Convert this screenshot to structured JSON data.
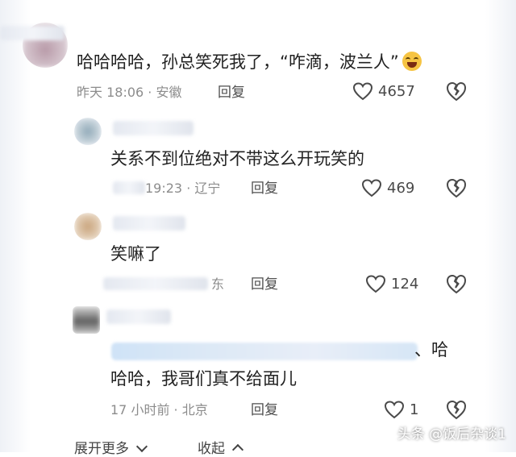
{
  "comments": [
    {
      "text": "哈哈哈哈，孙总笑死我了，“咋滴，波兰人”",
      "time": "昨天 18:06 · 安徽",
      "reply_label": "回复",
      "likes": "4657"
    },
    {
      "text": "关系不到位绝对不带这么开玩笑的",
      "time": "19:23 · 辽宁",
      "reply_label": "回复",
      "likes": "469"
    },
    {
      "text": "笑嘛了",
      "time": "东",
      "reply_label": "回复",
      "likes": "124"
    },
    {
      "text_tail": "、哈",
      "text_line2": "哈哈，我哥们真不给面儿",
      "time": "17 小时前 · 北京",
      "reply_label": "回复",
      "likes": "1"
    }
  ],
  "footer": {
    "expand_label": "展开更多",
    "collapse_label": "收起"
  },
  "watermark": "头条 @饭后杂谈1",
  "colors": {
    "text": "#222222",
    "meta": "#8c8c8c",
    "icon": "#4a4a4a"
  }
}
